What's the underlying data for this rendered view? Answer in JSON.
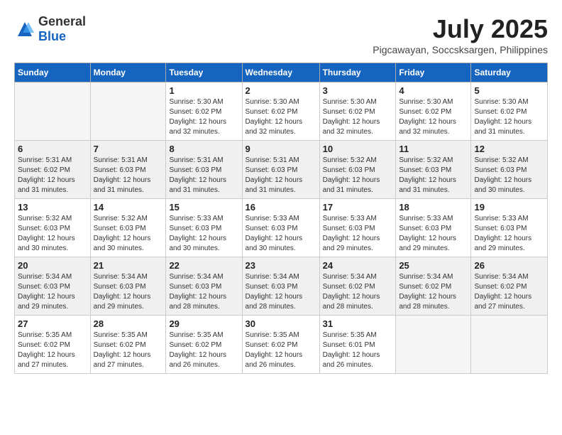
{
  "header": {
    "logo": {
      "general": "General",
      "blue": "Blue"
    },
    "title": "July 2025",
    "location": "Pigcawayan, Soccsksargen, Philippines"
  },
  "weekdays": [
    "Sunday",
    "Monday",
    "Tuesday",
    "Wednesday",
    "Thursday",
    "Friday",
    "Saturday"
  ],
  "weeks": [
    [
      {
        "day": "",
        "sunrise": "",
        "sunset": "",
        "daylight": "",
        "empty": true
      },
      {
        "day": "",
        "sunrise": "",
        "sunset": "",
        "daylight": "",
        "empty": true
      },
      {
        "day": "1",
        "sunrise": "Sunrise: 5:30 AM",
        "sunset": "Sunset: 6:02 PM",
        "daylight": "Daylight: 12 hours and 32 minutes.",
        "empty": false
      },
      {
        "day": "2",
        "sunrise": "Sunrise: 5:30 AM",
        "sunset": "Sunset: 6:02 PM",
        "daylight": "Daylight: 12 hours and 32 minutes.",
        "empty": false
      },
      {
        "day": "3",
        "sunrise": "Sunrise: 5:30 AM",
        "sunset": "Sunset: 6:02 PM",
        "daylight": "Daylight: 12 hours and 32 minutes.",
        "empty": false
      },
      {
        "day": "4",
        "sunrise": "Sunrise: 5:30 AM",
        "sunset": "Sunset: 6:02 PM",
        "daylight": "Daylight: 12 hours and 32 minutes.",
        "empty": false
      },
      {
        "day": "5",
        "sunrise": "Sunrise: 5:30 AM",
        "sunset": "Sunset: 6:02 PM",
        "daylight": "Daylight: 12 hours and 31 minutes.",
        "empty": false
      }
    ],
    [
      {
        "day": "6",
        "sunrise": "Sunrise: 5:31 AM",
        "sunset": "Sunset: 6:02 PM",
        "daylight": "Daylight: 12 hours and 31 minutes.",
        "empty": false
      },
      {
        "day": "7",
        "sunrise": "Sunrise: 5:31 AM",
        "sunset": "Sunset: 6:03 PM",
        "daylight": "Daylight: 12 hours and 31 minutes.",
        "empty": false
      },
      {
        "day": "8",
        "sunrise": "Sunrise: 5:31 AM",
        "sunset": "Sunset: 6:03 PM",
        "daylight": "Daylight: 12 hours and 31 minutes.",
        "empty": false
      },
      {
        "day": "9",
        "sunrise": "Sunrise: 5:31 AM",
        "sunset": "Sunset: 6:03 PM",
        "daylight": "Daylight: 12 hours and 31 minutes.",
        "empty": false
      },
      {
        "day": "10",
        "sunrise": "Sunrise: 5:32 AM",
        "sunset": "Sunset: 6:03 PM",
        "daylight": "Daylight: 12 hours and 31 minutes.",
        "empty": false
      },
      {
        "day": "11",
        "sunrise": "Sunrise: 5:32 AM",
        "sunset": "Sunset: 6:03 PM",
        "daylight": "Daylight: 12 hours and 31 minutes.",
        "empty": false
      },
      {
        "day": "12",
        "sunrise": "Sunrise: 5:32 AM",
        "sunset": "Sunset: 6:03 PM",
        "daylight": "Daylight: 12 hours and 30 minutes.",
        "empty": false
      }
    ],
    [
      {
        "day": "13",
        "sunrise": "Sunrise: 5:32 AM",
        "sunset": "Sunset: 6:03 PM",
        "daylight": "Daylight: 12 hours and 30 minutes.",
        "empty": false
      },
      {
        "day": "14",
        "sunrise": "Sunrise: 5:32 AM",
        "sunset": "Sunset: 6:03 PM",
        "daylight": "Daylight: 12 hours and 30 minutes.",
        "empty": false
      },
      {
        "day": "15",
        "sunrise": "Sunrise: 5:33 AM",
        "sunset": "Sunset: 6:03 PM",
        "daylight": "Daylight: 12 hours and 30 minutes.",
        "empty": false
      },
      {
        "day": "16",
        "sunrise": "Sunrise: 5:33 AM",
        "sunset": "Sunset: 6:03 PM",
        "daylight": "Daylight: 12 hours and 30 minutes.",
        "empty": false
      },
      {
        "day": "17",
        "sunrise": "Sunrise: 5:33 AM",
        "sunset": "Sunset: 6:03 PM",
        "daylight": "Daylight: 12 hours and 29 minutes.",
        "empty": false
      },
      {
        "day": "18",
        "sunrise": "Sunrise: 5:33 AM",
        "sunset": "Sunset: 6:03 PM",
        "daylight": "Daylight: 12 hours and 29 minutes.",
        "empty": false
      },
      {
        "day": "19",
        "sunrise": "Sunrise: 5:33 AM",
        "sunset": "Sunset: 6:03 PM",
        "daylight": "Daylight: 12 hours and 29 minutes.",
        "empty": false
      }
    ],
    [
      {
        "day": "20",
        "sunrise": "Sunrise: 5:34 AM",
        "sunset": "Sunset: 6:03 PM",
        "daylight": "Daylight: 12 hours and 29 minutes.",
        "empty": false
      },
      {
        "day": "21",
        "sunrise": "Sunrise: 5:34 AM",
        "sunset": "Sunset: 6:03 PM",
        "daylight": "Daylight: 12 hours and 29 minutes.",
        "empty": false
      },
      {
        "day": "22",
        "sunrise": "Sunrise: 5:34 AM",
        "sunset": "Sunset: 6:03 PM",
        "daylight": "Daylight: 12 hours and 28 minutes.",
        "empty": false
      },
      {
        "day": "23",
        "sunrise": "Sunrise: 5:34 AM",
        "sunset": "Sunset: 6:03 PM",
        "daylight": "Daylight: 12 hours and 28 minutes.",
        "empty": false
      },
      {
        "day": "24",
        "sunrise": "Sunrise: 5:34 AM",
        "sunset": "Sunset: 6:02 PM",
        "daylight": "Daylight: 12 hours and 28 minutes.",
        "empty": false
      },
      {
        "day": "25",
        "sunrise": "Sunrise: 5:34 AM",
        "sunset": "Sunset: 6:02 PM",
        "daylight": "Daylight: 12 hours and 28 minutes.",
        "empty": false
      },
      {
        "day": "26",
        "sunrise": "Sunrise: 5:34 AM",
        "sunset": "Sunset: 6:02 PM",
        "daylight": "Daylight: 12 hours and 27 minutes.",
        "empty": false
      }
    ],
    [
      {
        "day": "27",
        "sunrise": "Sunrise: 5:35 AM",
        "sunset": "Sunset: 6:02 PM",
        "daylight": "Daylight: 12 hours and 27 minutes.",
        "empty": false
      },
      {
        "day": "28",
        "sunrise": "Sunrise: 5:35 AM",
        "sunset": "Sunset: 6:02 PM",
        "daylight": "Daylight: 12 hours and 27 minutes.",
        "empty": false
      },
      {
        "day": "29",
        "sunrise": "Sunrise: 5:35 AM",
        "sunset": "Sunset: 6:02 PM",
        "daylight": "Daylight: 12 hours and 26 minutes.",
        "empty": false
      },
      {
        "day": "30",
        "sunrise": "Sunrise: 5:35 AM",
        "sunset": "Sunset: 6:02 PM",
        "daylight": "Daylight: 12 hours and 26 minutes.",
        "empty": false
      },
      {
        "day": "31",
        "sunrise": "Sunrise: 5:35 AM",
        "sunset": "Sunset: 6:01 PM",
        "daylight": "Daylight: 12 hours and 26 minutes.",
        "empty": false
      },
      {
        "day": "",
        "sunrise": "",
        "sunset": "",
        "daylight": "",
        "empty": true
      },
      {
        "day": "",
        "sunrise": "",
        "sunset": "",
        "daylight": "",
        "empty": true
      }
    ]
  ]
}
